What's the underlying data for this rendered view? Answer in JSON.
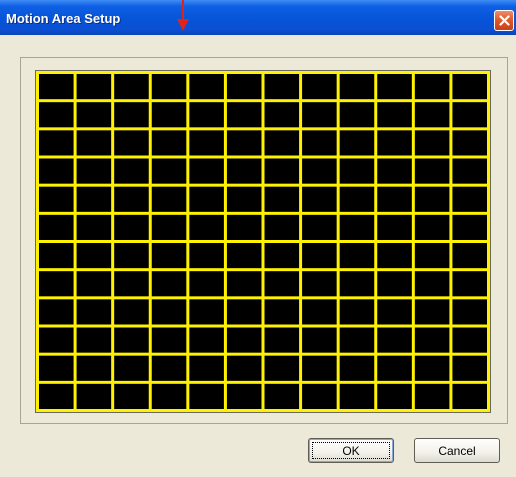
{
  "window": {
    "title": "Motion Area Setup",
    "close_icon": "close-icon"
  },
  "motion_grid": {
    "rows": 12,
    "cols": 12,
    "cell_color": "#000000",
    "line_color": "#fff200"
  },
  "buttons": {
    "ok_label": "OK",
    "cancel_label": "Cancel"
  },
  "annotation": {
    "arrow_icon": "red-arrow-down-icon",
    "arrow_color": "#e0241b"
  }
}
